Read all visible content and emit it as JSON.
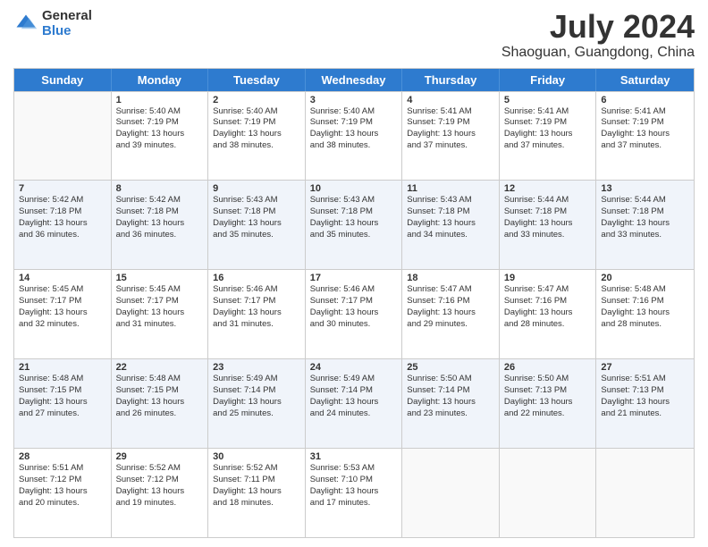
{
  "logo": {
    "general": "General",
    "blue": "Blue"
  },
  "title": "July 2024",
  "location": "Shaoguan, Guangdong, China",
  "days": [
    "Sunday",
    "Monday",
    "Tuesday",
    "Wednesday",
    "Thursday",
    "Friday",
    "Saturday"
  ],
  "weeks": [
    [
      {
        "day": "",
        "sunrise": "",
        "sunset": "",
        "daylight": ""
      },
      {
        "day": "1",
        "sunrise": "Sunrise: 5:40 AM",
        "sunset": "Sunset: 7:19 PM",
        "daylight": "Daylight: 13 hours and 39 minutes."
      },
      {
        "day": "2",
        "sunrise": "Sunrise: 5:40 AM",
        "sunset": "Sunset: 7:19 PM",
        "daylight": "Daylight: 13 hours and 38 minutes."
      },
      {
        "day": "3",
        "sunrise": "Sunrise: 5:40 AM",
        "sunset": "Sunset: 7:19 PM",
        "daylight": "Daylight: 13 hours and 38 minutes."
      },
      {
        "day": "4",
        "sunrise": "Sunrise: 5:41 AM",
        "sunset": "Sunset: 7:19 PM",
        "daylight": "Daylight: 13 hours and 37 minutes."
      },
      {
        "day": "5",
        "sunrise": "Sunrise: 5:41 AM",
        "sunset": "Sunset: 7:19 PM",
        "daylight": "Daylight: 13 hours and 37 minutes."
      },
      {
        "day": "6",
        "sunrise": "Sunrise: 5:41 AM",
        "sunset": "Sunset: 7:19 PM",
        "daylight": "Daylight: 13 hours and 37 minutes."
      }
    ],
    [
      {
        "day": "7",
        "sunrise": "Sunrise: 5:42 AM",
        "sunset": "Sunset: 7:18 PM",
        "daylight": "Daylight: 13 hours and 36 minutes."
      },
      {
        "day": "8",
        "sunrise": "Sunrise: 5:42 AM",
        "sunset": "Sunset: 7:18 PM",
        "daylight": "Daylight: 13 hours and 36 minutes."
      },
      {
        "day": "9",
        "sunrise": "Sunrise: 5:43 AM",
        "sunset": "Sunset: 7:18 PM",
        "daylight": "Daylight: 13 hours and 35 minutes."
      },
      {
        "day": "10",
        "sunrise": "Sunrise: 5:43 AM",
        "sunset": "Sunset: 7:18 PM",
        "daylight": "Daylight: 13 hours and 35 minutes."
      },
      {
        "day": "11",
        "sunrise": "Sunrise: 5:43 AM",
        "sunset": "Sunset: 7:18 PM",
        "daylight": "Daylight: 13 hours and 34 minutes."
      },
      {
        "day": "12",
        "sunrise": "Sunrise: 5:44 AM",
        "sunset": "Sunset: 7:18 PM",
        "daylight": "Daylight: 13 hours and 33 minutes."
      },
      {
        "day": "13",
        "sunrise": "Sunrise: 5:44 AM",
        "sunset": "Sunset: 7:18 PM",
        "daylight": "Daylight: 13 hours and 33 minutes."
      }
    ],
    [
      {
        "day": "14",
        "sunrise": "Sunrise: 5:45 AM",
        "sunset": "Sunset: 7:17 PM",
        "daylight": "Daylight: 13 hours and 32 minutes."
      },
      {
        "day": "15",
        "sunrise": "Sunrise: 5:45 AM",
        "sunset": "Sunset: 7:17 PM",
        "daylight": "Daylight: 13 hours and 31 minutes."
      },
      {
        "day": "16",
        "sunrise": "Sunrise: 5:46 AM",
        "sunset": "Sunset: 7:17 PM",
        "daylight": "Daylight: 13 hours and 31 minutes."
      },
      {
        "day": "17",
        "sunrise": "Sunrise: 5:46 AM",
        "sunset": "Sunset: 7:17 PM",
        "daylight": "Daylight: 13 hours and 30 minutes."
      },
      {
        "day": "18",
        "sunrise": "Sunrise: 5:47 AM",
        "sunset": "Sunset: 7:16 PM",
        "daylight": "Daylight: 13 hours and 29 minutes."
      },
      {
        "day": "19",
        "sunrise": "Sunrise: 5:47 AM",
        "sunset": "Sunset: 7:16 PM",
        "daylight": "Daylight: 13 hours and 28 minutes."
      },
      {
        "day": "20",
        "sunrise": "Sunrise: 5:48 AM",
        "sunset": "Sunset: 7:16 PM",
        "daylight": "Daylight: 13 hours and 28 minutes."
      }
    ],
    [
      {
        "day": "21",
        "sunrise": "Sunrise: 5:48 AM",
        "sunset": "Sunset: 7:15 PM",
        "daylight": "Daylight: 13 hours and 27 minutes."
      },
      {
        "day": "22",
        "sunrise": "Sunrise: 5:48 AM",
        "sunset": "Sunset: 7:15 PM",
        "daylight": "Daylight: 13 hours and 26 minutes."
      },
      {
        "day": "23",
        "sunrise": "Sunrise: 5:49 AM",
        "sunset": "Sunset: 7:14 PM",
        "daylight": "Daylight: 13 hours and 25 minutes."
      },
      {
        "day": "24",
        "sunrise": "Sunrise: 5:49 AM",
        "sunset": "Sunset: 7:14 PM",
        "daylight": "Daylight: 13 hours and 24 minutes."
      },
      {
        "day": "25",
        "sunrise": "Sunrise: 5:50 AM",
        "sunset": "Sunset: 7:14 PM",
        "daylight": "Daylight: 13 hours and 23 minutes."
      },
      {
        "day": "26",
        "sunrise": "Sunrise: 5:50 AM",
        "sunset": "Sunset: 7:13 PM",
        "daylight": "Daylight: 13 hours and 22 minutes."
      },
      {
        "day": "27",
        "sunrise": "Sunrise: 5:51 AM",
        "sunset": "Sunset: 7:13 PM",
        "daylight": "Daylight: 13 hours and 21 minutes."
      }
    ],
    [
      {
        "day": "28",
        "sunrise": "Sunrise: 5:51 AM",
        "sunset": "Sunset: 7:12 PM",
        "daylight": "Daylight: 13 hours and 20 minutes."
      },
      {
        "day": "29",
        "sunrise": "Sunrise: 5:52 AM",
        "sunset": "Sunset: 7:12 PM",
        "daylight": "Daylight: 13 hours and 19 minutes."
      },
      {
        "day": "30",
        "sunrise": "Sunrise: 5:52 AM",
        "sunset": "Sunset: 7:11 PM",
        "daylight": "Daylight: 13 hours and 18 minutes."
      },
      {
        "day": "31",
        "sunrise": "Sunrise: 5:53 AM",
        "sunset": "Sunset: 7:10 PM",
        "daylight": "Daylight: 13 hours and 17 minutes."
      },
      {
        "day": "",
        "sunrise": "",
        "sunset": "",
        "daylight": ""
      },
      {
        "day": "",
        "sunrise": "",
        "sunset": "",
        "daylight": ""
      },
      {
        "day": "",
        "sunrise": "",
        "sunset": "",
        "daylight": ""
      }
    ]
  ]
}
